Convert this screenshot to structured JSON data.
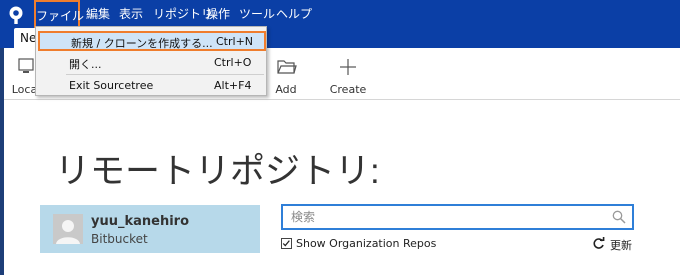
{
  "menubar": {
    "items": [
      {
        "label": "ファイル"
      },
      {
        "label": "編集"
      },
      {
        "label": "表示"
      },
      {
        "label": "リポジトリ"
      },
      {
        "label": "操作"
      },
      {
        "label": "ツール"
      },
      {
        "label": "ヘルプ"
      }
    ]
  },
  "tabs": {
    "active_label": "New tab"
  },
  "toolbar": {
    "local_label": "Local",
    "add_label": "Add",
    "create_label": "Create"
  },
  "file_menu": {
    "new_clone_label": "新規 / クローンを作成する...",
    "new_clone_shortcut": "Ctrl+N",
    "open_label": "開く...",
    "open_shortcut": "Ctrl+O",
    "exit_label": "Exit Sourcetree",
    "exit_shortcut": "Alt+F4"
  },
  "main": {
    "title": "リモートリポジトリ:",
    "account": {
      "name": "yuu_kanehiro",
      "service": "Bitbucket"
    },
    "search": {
      "placeholder": "検索",
      "value": ""
    },
    "show_org_label": "Show Organization Repos",
    "show_org_checked": true,
    "refresh_label": "更新"
  },
  "colors": {
    "titlebar": "#0b3fa6",
    "highlight": "#ef7d2d",
    "account_card": "#b7d9ea",
    "search_border": "#2f7fd8"
  }
}
